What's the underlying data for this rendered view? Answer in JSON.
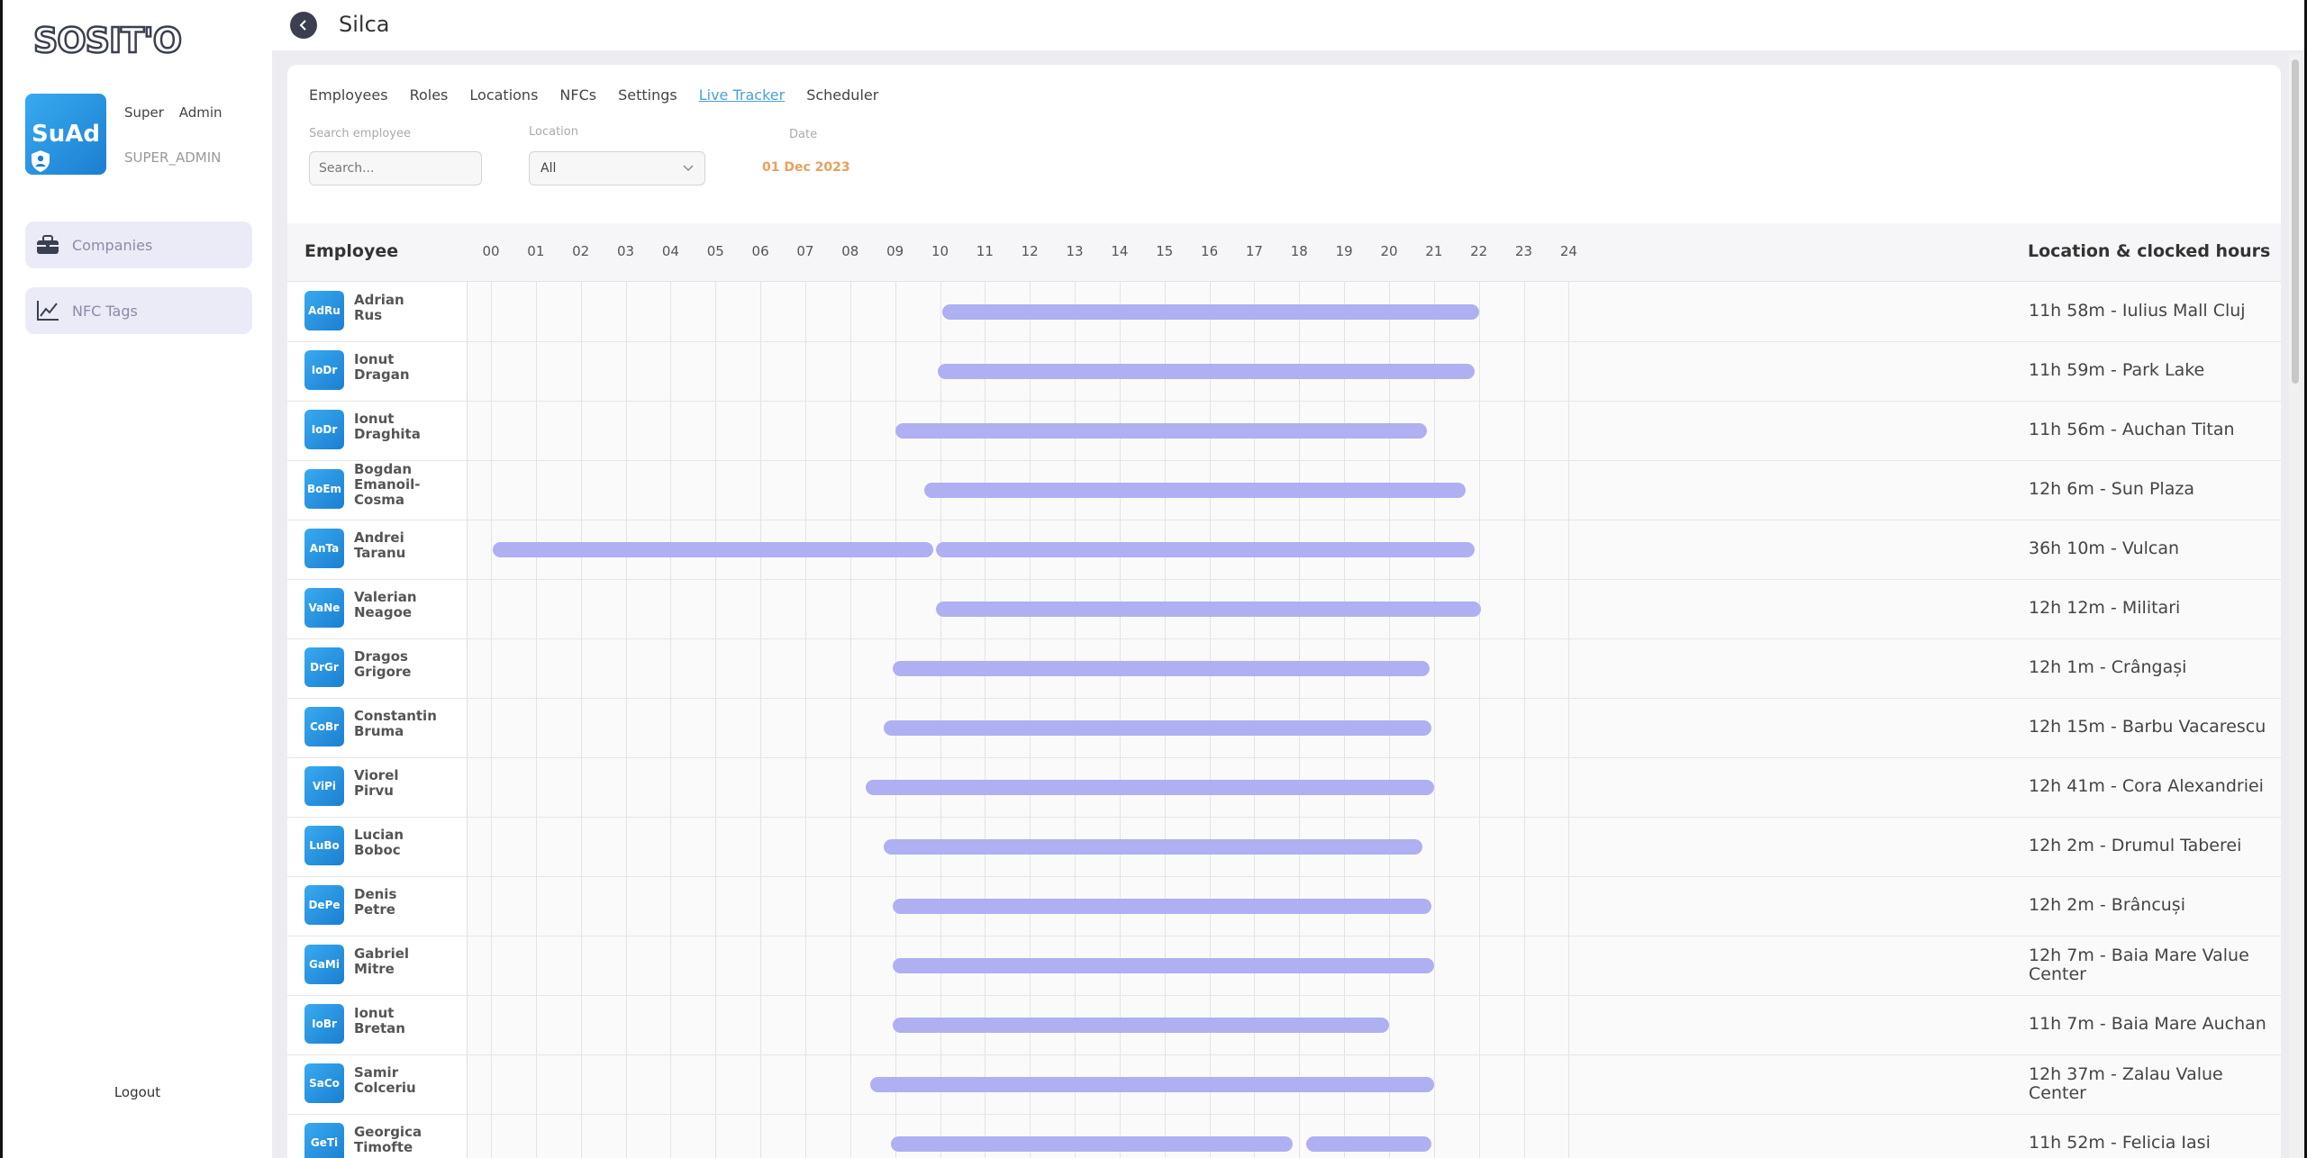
{
  "app": {
    "logo_text": "SOSIT'O",
    "page_title": "Silca"
  },
  "profile": {
    "initials": "SuAd",
    "name": "Super Admin",
    "role": "SUPER_ADMIN"
  },
  "sidebar": {
    "items": [
      {
        "label": "Companies",
        "icon": "toolbox-icon"
      },
      {
        "label": "NFC Tags",
        "icon": "chart-line-icon"
      }
    ],
    "logout_label": "Logout"
  },
  "tabs": [
    "Employees",
    "Roles",
    "Locations",
    "NFCs",
    "Settings",
    "Live Tracker",
    "Scheduler"
  ],
  "active_tab": "Live Tracker",
  "filters": {
    "search_label": "Search employee",
    "search_placeholder": "Search...",
    "location_label": "Location",
    "location_value": "All",
    "date_label": "Date",
    "date_value": "01 Dec 2023"
  },
  "grid": {
    "employee_header": "Employee",
    "location_header": "Location & clocked hours",
    "hours": [
      "00",
      "01",
      "02",
      "03",
      "04",
      "05",
      "06",
      "07",
      "08",
      "09",
      "10",
      "11",
      "12",
      "13",
      "14",
      "15",
      "16",
      "17",
      "18",
      "19",
      "20",
      "21",
      "22",
      "23",
      "24"
    ]
  },
  "rows": [
    {
      "initials": "AdRu",
      "first": "Adrian",
      "last": "Rus",
      "location": "11h 58m - Iulius Mall Cluj",
      "shifts": [
        [
          10.05,
          22.0
        ]
      ]
    },
    {
      "initials": "IoDr",
      "first": "Ionut",
      "last": "Dragan",
      "location": "11h 59m - Park Lake",
      "shifts": [
        [
          9.95,
          21.9
        ]
      ]
    },
    {
      "initials": "IoDr",
      "first": "Ionut",
      "last": "Draghita",
      "location": "11h 56m - Auchan Titan",
      "shifts": [
        [
          9.0,
          20.85
        ]
      ]
    },
    {
      "initials": "BoEm",
      "first": "Bogdan",
      "last": "Emanoil-Cosma",
      "location": "12h 6m - Sun Plaza",
      "shifts": [
        [
          9.65,
          21.7
        ]
      ]
    },
    {
      "initials": "AnTa",
      "first": "Andrei",
      "last": "Taranu",
      "location": "36h 10m - Vulcan",
      "shifts": [
        [
          0.05,
          9.85
        ],
        [
          9.9,
          21.9
        ]
      ]
    },
    {
      "initials": "VaNe",
      "first": "Valerian",
      "last": "Neagoe",
      "location": "12h 12m - Militari",
      "shifts": [
        [
          9.9,
          22.05
        ]
      ]
    },
    {
      "initials": "DrGr",
      "first": "Dragos",
      "last": "Grigore",
      "location": "12h 1m - Crângași",
      "shifts": [
        [
          8.95,
          20.9
        ]
      ]
    },
    {
      "initials": "CoBr",
      "first": "Constantin",
      "last": "Bruma",
      "location": "12h 15m - Barbu Vacarescu",
      "shifts": [
        [
          8.75,
          20.95
        ]
      ]
    },
    {
      "initials": "ViPi",
      "first": "Viorel",
      "last": "Pirvu",
      "location": "12h 41m - Cora Alexandriei",
      "shifts": [
        [
          8.35,
          21.0
        ]
      ]
    },
    {
      "initials": "LuBo",
      "first": "Lucian",
      "last": "Boboc",
      "location": "12h 2m - Drumul Taberei",
      "shifts": [
        [
          8.75,
          20.75
        ]
      ]
    },
    {
      "initials": "DePe",
      "first": "Denis",
      "last": "Petre",
      "location": "12h 2m - Brâncuși",
      "shifts": [
        [
          8.95,
          20.95
        ]
      ]
    },
    {
      "initials": "GaMi",
      "first": "Gabriel",
      "last": "Mitre",
      "location": "12h 7m - Baia Mare Value Center",
      "shifts": [
        [
          8.95,
          21.0
        ]
      ]
    },
    {
      "initials": "IoBr",
      "first": "Ionut",
      "last": "Bretan",
      "location": "11h 7m - Baia Mare Auchan",
      "shifts": [
        [
          8.95,
          20.0
        ]
      ]
    },
    {
      "initials": "SaCo",
      "first": "Samir",
      "last": "Colceriu",
      "location": "12h 37m - Zalau Value Center",
      "shifts": [
        [
          8.45,
          21.0
        ]
      ]
    },
    {
      "initials": "GeTi",
      "first": "Georgica",
      "last": "Timofte",
      "location": "11h 52m - Felicia Iasi",
      "shifts": [
        [
          8.9,
          17.85
        ],
        [
          18.15,
          20.95
        ]
      ]
    }
  ],
  "colors": {
    "bar": "#aeb0f2",
    "accent": "#4aa1d8",
    "date": "#e8a05c",
    "avatar": "#2b95e4"
  }
}
